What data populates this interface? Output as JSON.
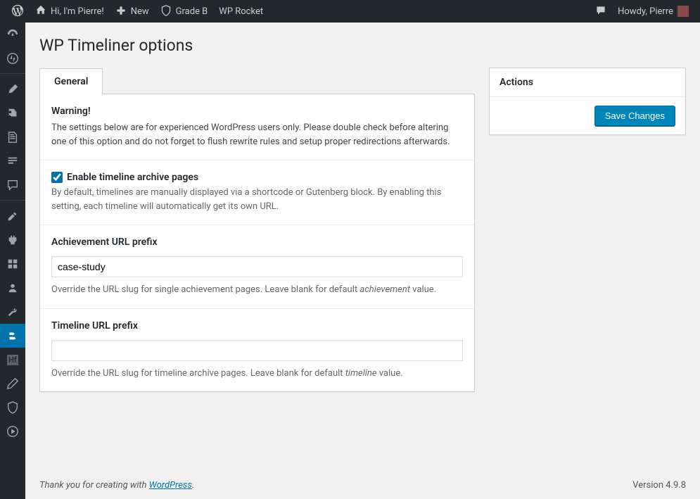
{
  "adminbar": {
    "site_name": "Hi, I'm Pierre!",
    "new_label": "New",
    "grade_label": "Grade B",
    "wprocket_label": "WP Rocket",
    "howdy": "Howdy, Pierre"
  },
  "page": {
    "title": "WP Timeliner options"
  },
  "tabs": {
    "general": "General"
  },
  "warning": {
    "heading": "Warning!",
    "text": "The settings below are for experienced WordPress users only. Please double check before altering one of this option and do not forget to flush rewrite rules and setup proper redirections afterwards."
  },
  "opt_archive": {
    "label": "Enable timeline archive pages",
    "checked": true,
    "desc": "By default, timelines are manually displayed via a shortcode or Gutenberg block. By enabling this setting, each timeline will automatically get its own URL."
  },
  "opt_achievement": {
    "label": "Achievement URL prefix",
    "value": "case-study",
    "desc_pre": "Override the URL slug for single achievement pages. Leave blank for default ",
    "desc_em": "achievement",
    "desc_post": " value."
  },
  "opt_timeline": {
    "label": "Timeline URL prefix",
    "value": "",
    "desc_pre": "Override the URL slug for timeline archive pages. Leave blank for default ",
    "desc_em": "timeline",
    "desc_post": " value."
  },
  "actions": {
    "heading": "Actions",
    "save": "Save Changes"
  },
  "footer": {
    "thanks_pre": "Thank you for creating with ",
    "wp": "WordPress",
    "thanks_post": ".",
    "version": "Version 4.9.8"
  }
}
